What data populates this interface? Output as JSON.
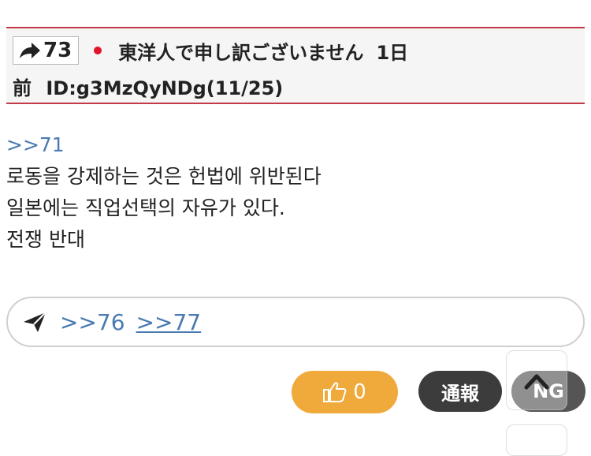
{
  "post": {
    "number": "73",
    "name": "東洋人で申し訳ございません",
    "date": "1日",
    "date2": "前",
    "id": "ID:g3MzQyNDg(11/25)",
    "anchor": ">>71",
    "lines": [
      "로동을 강제하는 것은 헌법에 위반된다",
      "일본에는 직업선택의 자유가 있다.",
      "전쟁 반대"
    ]
  },
  "replies": [
    ">>76",
    ">>77"
  ],
  "actions": {
    "like_count": "0",
    "report_label": "通報",
    "ng_label": "NG"
  },
  "colors": {
    "header_border": "#c23a47",
    "link": "#4a7ab0",
    "like_bg": "#f0a93b",
    "dark_btn": "#3c3c3c"
  },
  "icons": {
    "post_arrow": "share-arrow-icon",
    "flag": "japan-flag-icon",
    "send": "paper-plane-icon",
    "like": "thumbs-up-icon",
    "scroll_top": "arrow-up-icon"
  }
}
